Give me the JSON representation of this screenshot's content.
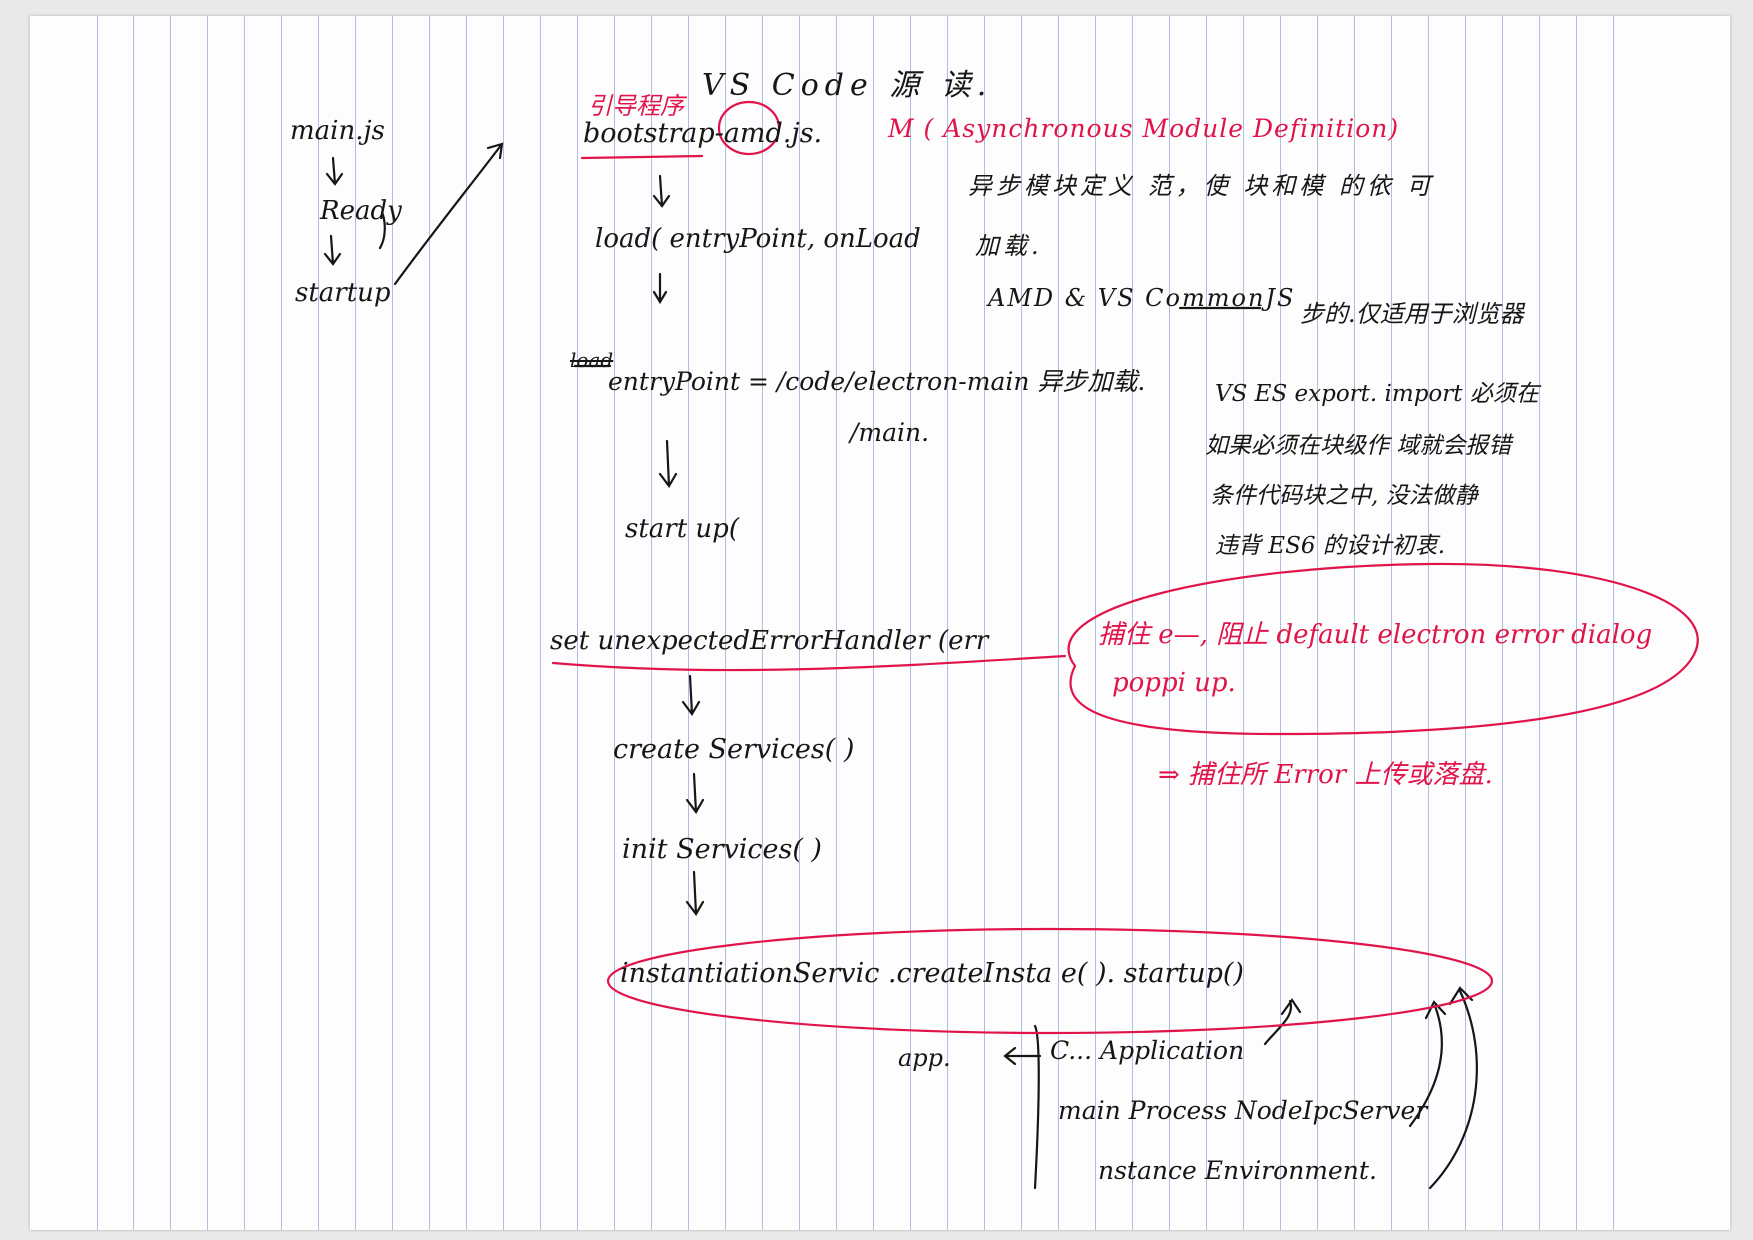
{
  "title": "VS Code 源 读.",
  "bootstrap": {
    "label_cn": "引导程序",
    "file": "bootstrap-amd.js."
  },
  "amd_note": {
    "heading": "M ( Asynchronous Module Definition)",
    "line1": "异步模块定义 范，使 块和模 的依 可",
    "line2": "加载."
  },
  "commonjs_note": {
    "line": "AMD & VS CommonJS",
    "tail": "步的.仅适用于浏览器"
  },
  "es_note": {
    "line1": "VS ES export. import 必须在",
    "line2": "如果必须在块级作 域就会报错",
    "line3": "条件代码块之中, 没法做静",
    "line4": "违背 ES6 的设计初衷."
  },
  "main_flow": [
    "main.js",
    "Ready",
    "startup"
  ],
  "steps": {
    "load": "load( entryPoint, onLoad",
    "entry_struck": "load",
    "entry": "entryPoint = /code/electron-main 异步加载.",
    "entry2": "/main.",
    "startup": "start up(",
    "error_handler": "set unexpectedErrorHandler (err",
    "create_services": "create Services( )",
    "init_services": "init Services( )",
    "instantiation": "instantiationServic .createInsta e( ). startup()"
  },
  "error_note": {
    "line1": "捕住 e—, 阻止 default electron error dialog",
    "line2": "poppi up.",
    "line3": "⇒ 捕住所 Error 上传或落盘."
  },
  "deps": {
    "app": "app.",
    "item1": "C... Application",
    "item2": "main Process NodeIpcServer",
    "item3": "nstance Environment."
  },
  "colors": {
    "ink": "#161616",
    "red": "#e0144a",
    "rule": "#aebfdd",
    "paper": "#fdfdfd"
  }
}
